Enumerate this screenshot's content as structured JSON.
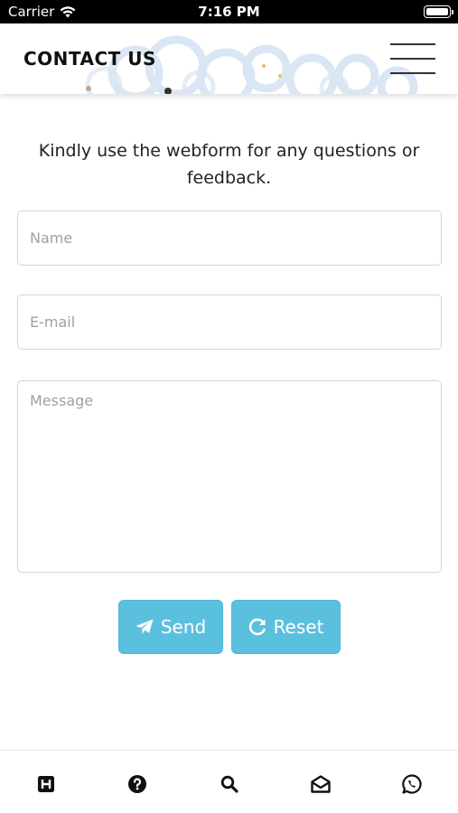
{
  "status_bar": {
    "carrier": "Carrier",
    "time": "7:16 PM",
    "icons": [
      "wifi-icon",
      "battery-icon"
    ]
  },
  "header": {
    "title": "CONTACT US",
    "menu_icon": "hamburger-menu-icon"
  },
  "intro": {
    "text": "Kindly use the webform for any questions or feedback."
  },
  "form": {
    "name": {
      "placeholder": "Name",
      "value": ""
    },
    "email": {
      "placeholder": "E-mail",
      "value": ""
    },
    "message": {
      "placeholder": "Message",
      "value": ""
    },
    "send": {
      "label": "Send",
      "icon": "paper-plane-icon"
    },
    "reset": {
      "label": "Reset",
      "icon": "redo-icon"
    }
  },
  "tab_bar": {
    "items": [
      {
        "icon": "home-h-icon"
      },
      {
        "icon": "question-circle-icon"
      },
      {
        "icon": "search-icon"
      },
      {
        "icon": "envelope-open-icon"
      },
      {
        "icon": "whatsapp-icon"
      }
    ]
  },
  "colors": {
    "accent": "#5bc0de",
    "button_text": "#ffffff",
    "status_bar": "#000000"
  }
}
